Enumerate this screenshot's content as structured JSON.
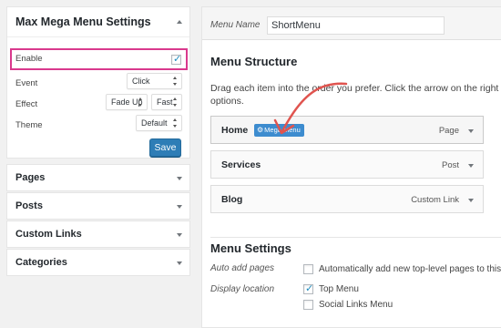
{
  "mmm_settings": {
    "title": "Max Mega Menu Settings",
    "enable_label": "Enable",
    "enable_checked": true,
    "event_label": "Event",
    "event_value": "Click",
    "effect_label": "Effect",
    "effect_value": "Fade Up",
    "effect_speed_value": "Fast",
    "theme_label": "Theme",
    "theme_value": "Default",
    "save_label": "Save"
  },
  "accordion": [
    {
      "label": "Pages"
    },
    {
      "label": "Posts"
    },
    {
      "label": "Custom Links"
    },
    {
      "label": "Categories"
    }
  ],
  "menu_name": {
    "label": "Menu Name",
    "value": "ShortMenu"
  },
  "menu_structure": {
    "title": "Menu Structure",
    "description": "Drag each item into the order you prefer. Click the arrow on the right of the item to reveal additional configuration options.",
    "description_visible": "Drag each item into the order you prefer. Click the arrow on the right of",
    "description_line2": "options.",
    "items": [
      {
        "title": "Home",
        "type": "Page",
        "badge": "Mega Menu"
      },
      {
        "title": "Services",
        "type": "Post"
      },
      {
        "title": "Blog",
        "type": "Custom Link"
      }
    ]
  },
  "menu_settings": {
    "title": "Menu Settings",
    "auto_add_label": "Auto add pages",
    "auto_add_text": "Automatically add new top-level pages to this",
    "display_location_label": "Display location",
    "locations": [
      {
        "label": "Top Menu",
        "checked": true
      },
      {
        "label": "Social Links Menu",
        "checked": false
      }
    ]
  },
  "colors": {
    "highlight_border": "#d9398d",
    "primary_button": "#2e7db6",
    "badge": "#3d8ccf",
    "annotation_arrow": "#e0544f"
  }
}
